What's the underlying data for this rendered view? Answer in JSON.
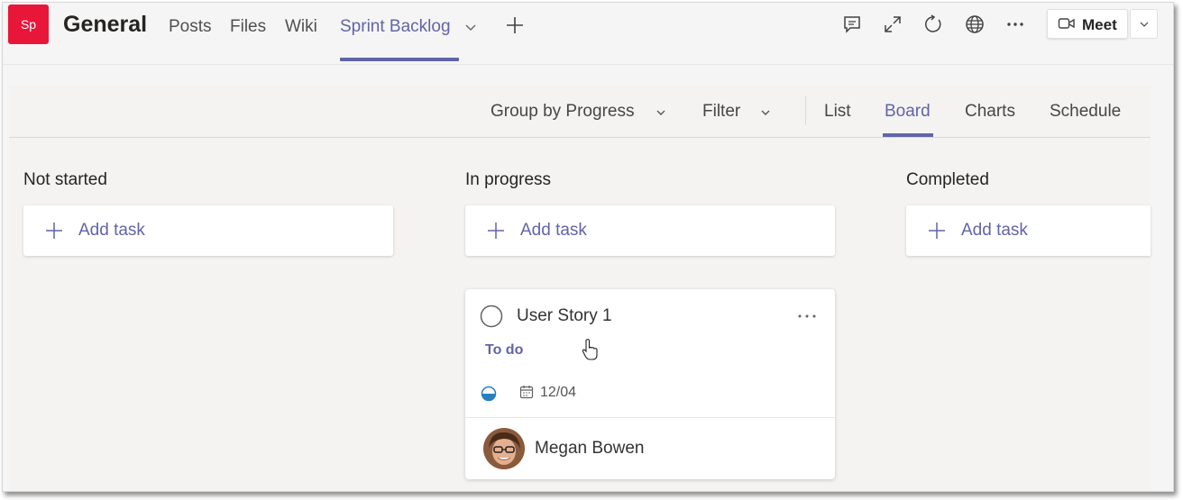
{
  "team": {
    "initials": "Sp",
    "channel": "General"
  },
  "tabs": [
    {
      "label": "Posts"
    },
    {
      "label": "Files"
    },
    {
      "label": "Wiki"
    },
    {
      "label": "Sprint Backlog"
    }
  ],
  "meet": {
    "label": "Meet"
  },
  "toolbar": {
    "group_by": "Group by Progress",
    "filter": "Filter",
    "views": [
      "List",
      "Board",
      "Charts",
      "Schedule"
    ],
    "active_view": "Board"
  },
  "columns": [
    {
      "title": "Not started",
      "add_label": "Add task"
    },
    {
      "title": "In progress",
      "add_label": "Add task"
    },
    {
      "title": "Completed",
      "add_label": "Add task"
    }
  ],
  "task": {
    "title": "User Story 1",
    "bucket": "To do",
    "due": "12/04",
    "assignee": "Megan Bowen",
    "progress_fraction": 0.5
  },
  "icons": {
    "plus_tab": "plus-icon",
    "conversation": "chat-icon",
    "expand": "expand-icon",
    "reload": "reload-icon",
    "website": "globe-icon",
    "more": "more-icon",
    "meet": "video-camera-icon"
  },
  "colors": {
    "accent": "#6264a7",
    "team_tile": "#e8173a",
    "progress": "#2a7fbf"
  }
}
